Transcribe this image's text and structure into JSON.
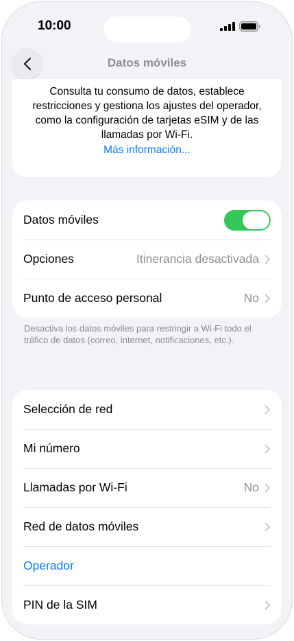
{
  "status_bar": {
    "time": "10:00"
  },
  "nav": {
    "title": "Datos móviles"
  },
  "info": {
    "text": "Consulta tu consumo de datos, establece restricciones y gestiona los ajustes del operador, como la configuración de tarjetas eSIM y de las llamadas por Wi-Fi.",
    "link": "Más información..."
  },
  "group1": {
    "rows": [
      {
        "label": "Datos móviles",
        "toggle_on": true
      },
      {
        "label": "Opciones",
        "value": "Itinerancia desactivada"
      },
      {
        "label": "Punto de acceso personal",
        "value": "No"
      }
    ],
    "footnote": "Desactiva los datos móviles para restringir a Wi-Fi todo el tráfico de datos (correo, internet, notificaciones, etc.)."
  },
  "group2": {
    "rows": [
      {
        "label": "Selección de red"
      },
      {
        "label": "Mi número"
      },
      {
        "label": "Llamadas por Wi-Fi",
        "value": "No"
      },
      {
        "label": "Red de datos móviles"
      },
      {
        "label": "Operador"
      },
      {
        "label": "PIN de la SIM"
      }
    ]
  },
  "colors": {
    "accent": "#0a7aff",
    "toggle_on": "#34c759",
    "background": "#f2f2f7"
  }
}
